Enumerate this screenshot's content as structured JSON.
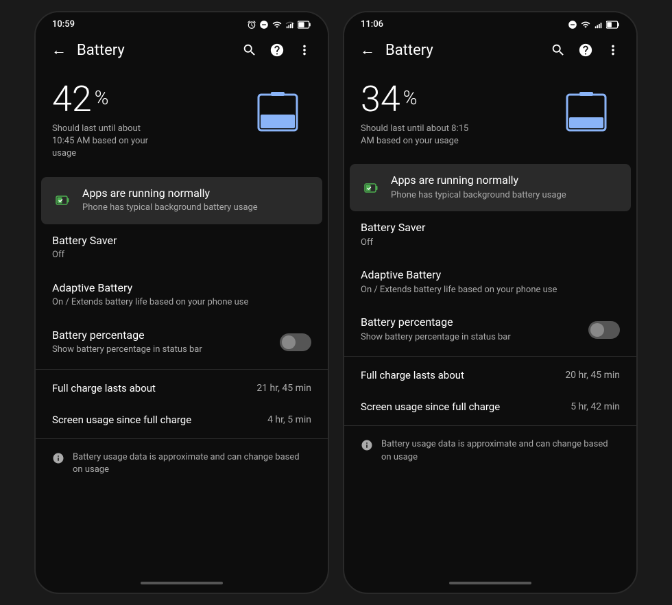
{
  "phones": [
    {
      "id": "phone-left",
      "status_bar": {
        "time": "10:59",
        "icons": [
          "alarm",
          "minus-circle",
          "wifi",
          "signal",
          "battery"
        ]
      },
      "app_bar": {
        "title": "Battery",
        "back_label": "←",
        "search_label": "🔍",
        "help_label": "?",
        "more_label": "⋮"
      },
      "battery": {
        "percentage": "42",
        "percent_sign": "%",
        "estimate": "Should last until about\n10:45 AM based on your\nusage"
      },
      "menu_items": [
        {
          "type": "highlight",
          "title": "Apps are running normally",
          "subtitle": "Phone has typical background battery usage",
          "has_icon": true,
          "icon": "battery-check"
        },
        {
          "type": "normal",
          "title": "Battery Saver",
          "subtitle": "Off",
          "has_icon": false
        },
        {
          "type": "normal",
          "title": "Adaptive Battery",
          "subtitle": "On / Extends battery life based on your phone use",
          "has_icon": false
        },
        {
          "type": "toggle",
          "title": "Battery percentage",
          "subtitle": "Show battery percentage in status bar",
          "has_icon": false,
          "toggle_on": false
        }
      ],
      "info_rows": [
        {
          "label": "Full charge lasts about",
          "value": "21 hr, 45 min"
        },
        {
          "label": "Screen usage since full charge",
          "value": "4 hr, 5 min"
        }
      ],
      "footer_note": "Battery usage data is approximate and can change based on usage"
    },
    {
      "id": "phone-right",
      "status_bar": {
        "time": "11:06",
        "icons": [
          "minus-circle",
          "wifi-full",
          "signal",
          "battery"
        ]
      },
      "app_bar": {
        "title": "Battery",
        "back_label": "←",
        "search_label": "🔍",
        "help_label": "?",
        "more_label": "⋮"
      },
      "battery": {
        "percentage": "34",
        "percent_sign": "%",
        "estimate": "Should last until about 8:15\nAM based on your usage"
      },
      "menu_items": [
        {
          "type": "highlight",
          "title": "Apps are running normally",
          "subtitle": "Phone has typical background battery usage",
          "has_icon": true,
          "icon": "battery-check"
        },
        {
          "type": "normal",
          "title": "Battery Saver",
          "subtitle": "Off",
          "has_icon": false
        },
        {
          "type": "normal",
          "title": "Adaptive Battery",
          "subtitle": "On / Extends battery life based on your phone use",
          "has_icon": false
        },
        {
          "type": "toggle",
          "title": "Battery percentage",
          "subtitle": "Show battery percentage in status bar",
          "has_icon": false,
          "toggle_on": false
        }
      ],
      "info_rows": [
        {
          "label": "Full charge lasts about",
          "value": "20 hr, 45 min"
        },
        {
          "label": "Screen usage since full charge",
          "value": "5 hr, 42 min"
        }
      ],
      "footer_note": "Battery usage data is approximate and can change based on usage"
    }
  ],
  "colors": {
    "battery_icon": "#8ab4f8",
    "battery_icon_fill": "#7baaf7",
    "green_icon": "#4caf50",
    "background": "#0d0d0d",
    "text_primary": "#ffffff",
    "text_secondary": "#aaaaaa"
  }
}
